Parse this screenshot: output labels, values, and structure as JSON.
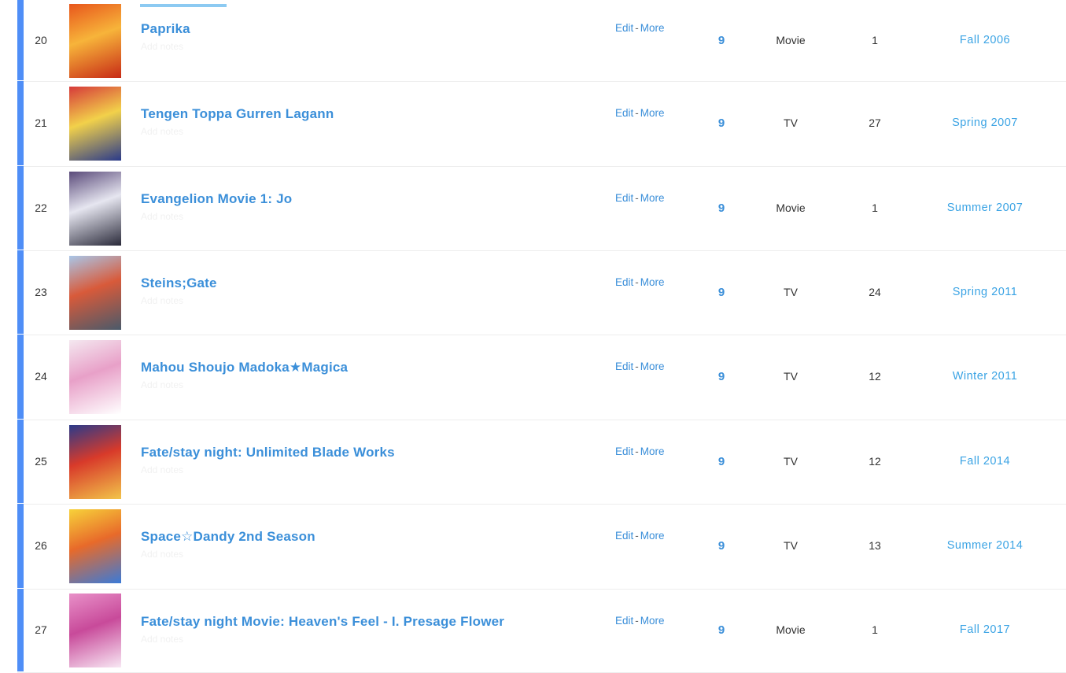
{
  "list": {
    "edit_label": "Edit",
    "separator": "-",
    "more_label": "More",
    "notes_placeholder": "Add notes",
    "rows": [
      {
        "rank": "20",
        "title": "Paprika",
        "score": "9",
        "type": "Movie",
        "episodes": "1",
        "season": "Fall 2006",
        "cover_colors": [
          "#e8561c",
          "#f7b43a",
          "#c72a16"
        ]
      },
      {
        "rank": "21",
        "title": "Tengen Toppa Gurren Lagann",
        "score": "9",
        "type": "TV",
        "episodes": "27",
        "season": "Spring 2007",
        "cover_colors": [
          "#d63a3a",
          "#f2d14a",
          "#2a3a8a"
        ]
      },
      {
        "rank": "22",
        "title": "Evangelion Movie 1: Jo",
        "score": "9",
        "type": "Movie",
        "episodes": "1",
        "season": "Summer 2007",
        "cover_colors": [
          "#5a4a7a",
          "#e6e6f0",
          "#2a2a3a"
        ]
      },
      {
        "rank": "23",
        "title": "Steins;Gate",
        "score": "9",
        "type": "TV",
        "episodes": "24",
        "season": "Spring 2011",
        "cover_colors": [
          "#a9c6e8",
          "#d85a3a",
          "#4a5a6a"
        ]
      },
      {
        "rank": "24",
        "title": "Mahou Shoujo Madoka★Magica",
        "score": "9",
        "type": "TV",
        "episodes": "12",
        "season": "Winter 2011",
        "cover_colors": [
          "#f4e8f0",
          "#e8a0c8",
          "#ffffff"
        ]
      },
      {
        "rank": "25",
        "title": "Fate/stay night: Unlimited Blade Works",
        "score": "9",
        "type": "TV",
        "episodes": "12",
        "season": "Fall 2014",
        "cover_colors": [
          "#2a3a8a",
          "#d83a2a",
          "#f2c44a"
        ]
      },
      {
        "rank": "26",
        "title": "Space☆Dandy 2nd Season",
        "score": "9",
        "type": "TV",
        "episodes": "13",
        "season": "Summer 2014",
        "cover_colors": [
          "#f7d23a",
          "#e86a2a",
          "#3a7ad8"
        ]
      },
      {
        "rank": "27",
        "title": "Fate/stay night Movie: Heaven's Feel - I. Presage Flower",
        "score": "9",
        "type": "Movie",
        "episodes": "1",
        "season": "Fall 2017",
        "cover_colors": [
          "#e890c8",
          "#c84a9a",
          "#f8e8f4"
        ]
      }
    ]
  },
  "colors": {
    "status_bar": "#4f8ef7",
    "link": "#3b8fd9",
    "season": "#3aa3e4"
  }
}
